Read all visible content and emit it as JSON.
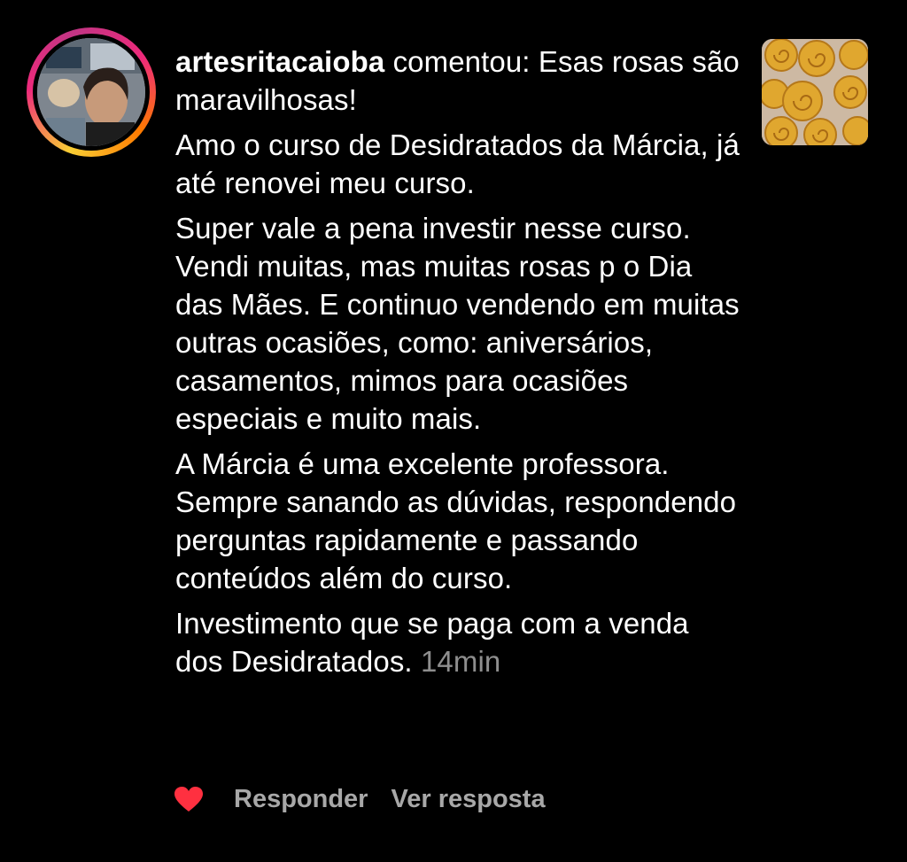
{
  "comment": {
    "username": "artesritacaioba",
    "verb": "comentou:",
    "paragraphs": [
      "Esas rosas são  maravilhosas!",
      "Amo o curso de Desidratados da Márcia,  já até renovei meu curso.",
      "Super vale a pena  investir nesse curso.  Vendi muitas,  mas muitas rosas  p o Dia das Mães.  E continuo vendendo em muitas outras ocasiões, como: aniversários, casamentos, mimos para ocasiões especiais  e muito mais.",
      "A Márcia é  uma excelente professora.  Sempre sanando as dúvidas, respondendo perguntas rapidamente  e passando conteúdos além  do curso.",
      "Investimento  que se paga com a venda dos Desidratados."
    ],
    "time": "14min"
  },
  "actions": {
    "like_icon": "heart-icon",
    "reply_label": "Responder",
    "view_reply_label": "Ver resposta"
  },
  "colors": {
    "background": "#000000",
    "text": "#ffffff",
    "muted": "#8e8e8e",
    "heart": "#ff3040"
  }
}
